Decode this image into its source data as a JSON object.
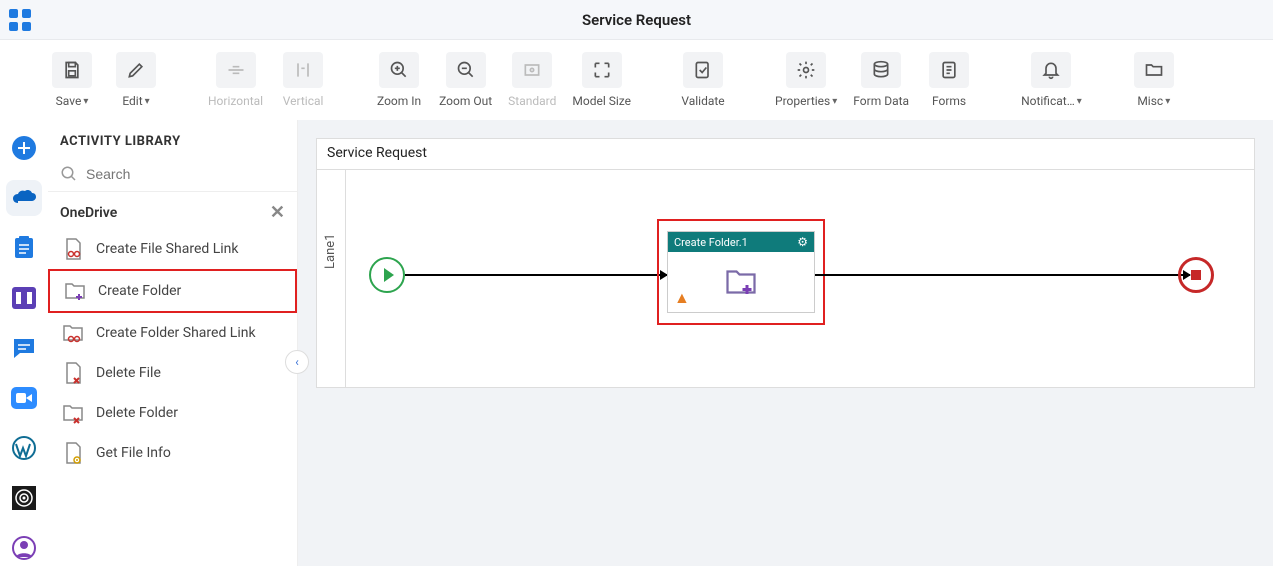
{
  "header": {
    "title": "Service Request"
  },
  "toolbar": {
    "save": "Save",
    "edit": "Edit",
    "horizontal": "Horizontal",
    "vertical": "Vertical",
    "zoom_in": "Zoom In",
    "zoom_out": "Zoom Out",
    "standard": "Standard",
    "model_size": "Model Size",
    "validate": "Validate",
    "properties": "Properties",
    "form_data": "Form Data",
    "forms": "Forms",
    "notifications": "Notificat…",
    "misc": "Misc"
  },
  "panel": {
    "heading": "ACTIVITY LIBRARY",
    "search_placeholder": "Search",
    "category": "OneDrive",
    "items": [
      {
        "label": "Create File Shared Link"
      },
      {
        "label": "Create Folder"
      },
      {
        "label": "Create Folder Shared Link"
      },
      {
        "label": "Delete File"
      },
      {
        "label": "Delete Folder"
      },
      {
        "label": "Get File Info"
      }
    ]
  },
  "canvas": {
    "title": "Service Request",
    "lane": "Lane1",
    "node_title": "Create Folder.1"
  }
}
